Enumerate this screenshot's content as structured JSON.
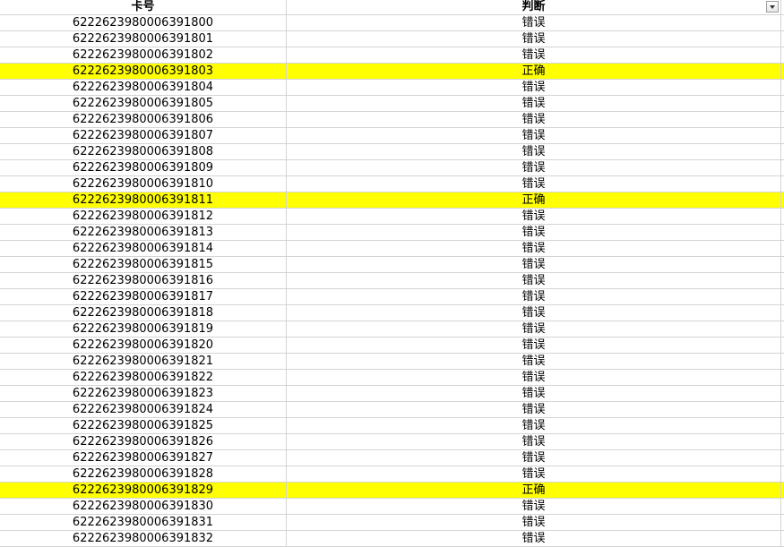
{
  "header": {
    "col_card": "卡号",
    "col_judge": "判断"
  },
  "highlight_color": "#ffff00",
  "rows": [
    {
      "card": "6222623980006391800",
      "result": "错误",
      "highlight": false
    },
    {
      "card": "6222623980006391801",
      "result": "错误",
      "highlight": false
    },
    {
      "card": "6222623980006391802",
      "result": "错误",
      "highlight": false
    },
    {
      "card": "6222623980006391803",
      "result": "正确",
      "highlight": true
    },
    {
      "card": "6222623980006391804",
      "result": "错误",
      "highlight": false
    },
    {
      "card": "6222623980006391805",
      "result": "错误",
      "highlight": false
    },
    {
      "card": "6222623980006391806",
      "result": "错误",
      "highlight": false
    },
    {
      "card": "6222623980006391807",
      "result": "错误",
      "highlight": false
    },
    {
      "card": "6222623980006391808",
      "result": "错误",
      "highlight": false
    },
    {
      "card": "6222623980006391809",
      "result": "错误",
      "highlight": false
    },
    {
      "card": "6222623980006391810",
      "result": "错误",
      "highlight": false
    },
    {
      "card": "6222623980006391811",
      "result": "正确",
      "highlight": true
    },
    {
      "card": "6222623980006391812",
      "result": "错误",
      "highlight": false
    },
    {
      "card": "6222623980006391813",
      "result": "错误",
      "highlight": false
    },
    {
      "card": "6222623980006391814",
      "result": "错误",
      "highlight": false
    },
    {
      "card": "6222623980006391815",
      "result": "错误",
      "highlight": false
    },
    {
      "card": "6222623980006391816",
      "result": "错误",
      "highlight": false
    },
    {
      "card": "6222623980006391817",
      "result": "错误",
      "highlight": false
    },
    {
      "card": "6222623980006391818",
      "result": "错误",
      "highlight": false
    },
    {
      "card": "6222623980006391819",
      "result": "错误",
      "highlight": false
    },
    {
      "card": "6222623980006391820",
      "result": "错误",
      "highlight": false
    },
    {
      "card": "6222623980006391821",
      "result": "错误",
      "highlight": false
    },
    {
      "card": "6222623980006391822",
      "result": "错误",
      "highlight": false
    },
    {
      "card": "6222623980006391823",
      "result": "错误",
      "highlight": false
    },
    {
      "card": "6222623980006391824",
      "result": "错误",
      "highlight": false
    },
    {
      "card": "6222623980006391825",
      "result": "错误",
      "highlight": false
    },
    {
      "card": "6222623980006391826",
      "result": "错误",
      "highlight": false
    },
    {
      "card": "6222623980006391827",
      "result": "错误",
      "highlight": false
    },
    {
      "card": "6222623980006391828",
      "result": "错误",
      "highlight": false
    },
    {
      "card": "6222623980006391829",
      "result": "正确",
      "highlight": true
    },
    {
      "card": "6222623980006391830",
      "result": "错误",
      "highlight": false
    },
    {
      "card": "6222623980006391831",
      "result": "错误",
      "highlight": false
    },
    {
      "card": "6222623980006391832",
      "result": "错误",
      "highlight": false
    }
  ]
}
